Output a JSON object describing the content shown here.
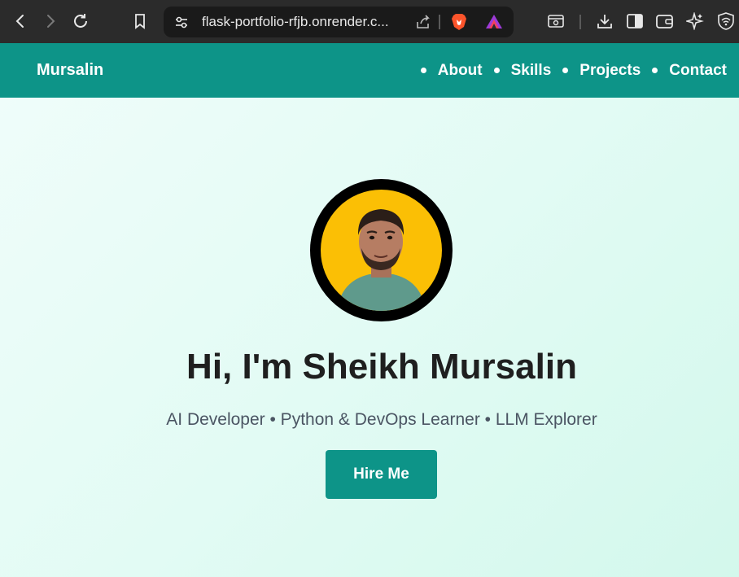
{
  "browser": {
    "url": "flask-portfolio-rfjb.onrender.c...",
    "icons": [
      "back-icon",
      "forward-icon",
      "reload-icon",
      "bookmark-icon",
      "site-settings-icon",
      "share-icon",
      "brave-shields-icon",
      "brave-rewards-icon",
      "reader-mode-icon",
      "downloads-icon",
      "sidebar-icon",
      "wallet-icon",
      "leo-ai-icon",
      "vpn-icon"
    ],
    "colors": {
      "chrome": "#2b2b2b",
      "urlbar": "#1a1a1a"
    }
  },
  "nav": {
    "brand": "Mursalin",
    "items": [
      "About",
      "Skills",
      "Projects",
      "Contact"
    ],
    "color": "#0d9488"
  },
  "hero": {
    "title": "Hi, I'm Sheikh Mursalin",
    "subtitle": "AI Developer • Python & DevOps Learner • LLM Explorer",
    "cta": "Hire Me",
    "avatar_bg": "#fbbf05"
  }
}
